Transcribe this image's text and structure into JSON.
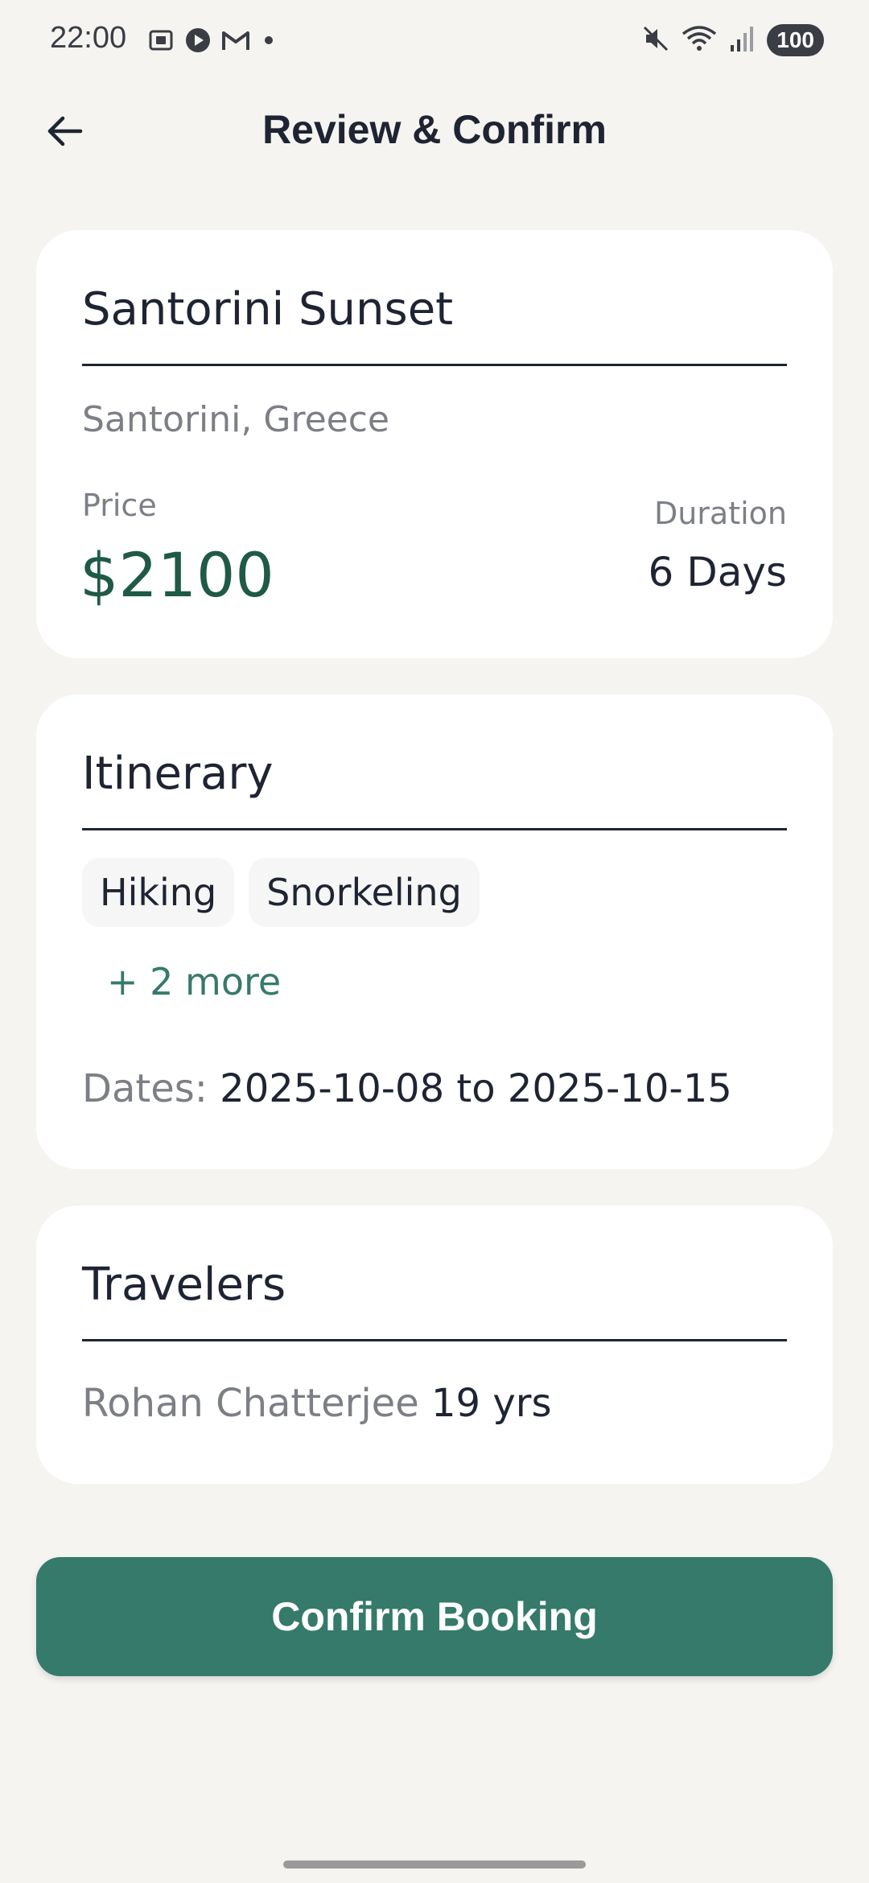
{
  "status_bar": {
    "time": "22:00",
    "battery": "100",
    "icons": [
      "screenshot-icon",
      "media-icon",
      "gmail-icon",
      "notification-dot-icon",
      "mute-icon",
      "wifi-icon",
      "signal-icon",
      "battery-icon"
    ]
  },
  "header": {
    "title": "Review & Confirm",
    "back_icon": "back-arrow-icon"
  },
  "trip": {
    "name": "Santorini Sunset",
    "location": "Santorini, Greece",
    "price_label": "Price",
    "price": "$2100",
    "duration_label": "Duration",
    "duration": "6 Days"
  },
  "itinerary": {
    "title": "Itinerary",
    "activities": [
      "Hiking",
      "Snorkeling"
    ],
    "more": "+ 2 more",
    "dates_label": "Dates:",
    "dates_value": "2025-10-08 to 2025-10-15"
  },
  "travelers": {
    "title": "Travelers",
    "list": [
      {
        "name": "Rohan Chatterjee",
        "age": "19 yrs"
      }
    ]
  },
  "actions": {
    "confirm_label": "Confirm Booking"
  },
  "colors": {
    "background": "#f5f4f1",
    "card": "#ffffff",
    "accent": "#357a6b",
    "price": "#1f5a46",
    "text_primary": "#1f2433",
    "text_secondary": "#7d7f86"
  }
}
